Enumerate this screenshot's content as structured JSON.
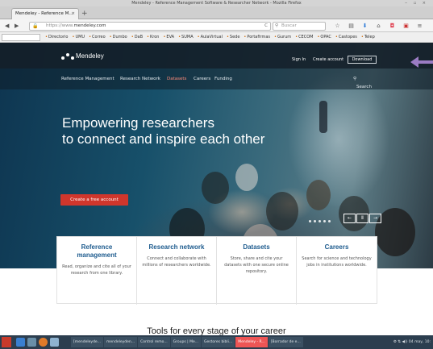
{
  "window": {
    "title": "Mendeley - Reference Management Software & Researcher Network - Mozilla Firefox",
    "controls": "‒ ▫ ×"
  },
  "tab": {
    "title": "Mendeley - Reference M...",
    "close": "×",
    "new_tab": "+"
  },
  "navbar": {
    "back": "◀",
    "forward": "▶",
    "url_prefix": "https://www.",
    "url_host": "mendeley.com",
    "reload": "C",
    "search_placeholder": "Buscar",
    "icons": [
      "star-icon",
      "reading-list-icon",
      "download-icon",
      "home-icon",
      "pocket-icon",
      "firefox-menu-icon",
      "hamburger-icon"
    ]
  },
  "bookmarks": [
    "Directorio",
    "UMU",
    "Correo",
    "Dumbo",
    "DaB",
    "Kron",
    "EVA",
    "SUMA",
    "AulaVirtual",
    "Sede",
    "Portafirmas",
    "Gurum",
    "CECOM",
    "OPAC",
    "Castopes",
    "Telep"
  ],
  "site": {
    "logo": "Mendeley",
    "signin": "Sign In",
    "create_account": "Create account",
    "download": "Download",
    "nav": [
      {
        "label": "Reference Management",
        "active": false
      },
      {
        "label": "Research Network",
        "active": false
      },
      {
        "label": "Datasets",
        "active": true
      },
      {
        "label": "Careers",
        "active": false
      },
      {
        "label": "Funding",
        "active": false
      }
    ],
    "search": "Search",
    "headline_1": "Empowering researchers",
    "headline_2": "to connect and inspire each other",
    "cta": "Create a free account",
    "carousel": {
      "prev": "←",
      "pause": "Ⅱ",
      "next": "→"
    },
    "cards": [
      {
        "title": "Reference management",
        "text": "Read, organize and cite all of your research from one library."
      },
      {
        "title": "Research network",
        "text": "Connect and collaborate with millions of researchers worldwide."
      },
      {
        "title": "Datasets",
        "text": "Store, share and cite your datasets with one secure online repository."
      },
      {
        "title": "Careers",
        "text": "Search for science and technology jobs in institutions worldwide."
      }
    ],
    "tools_heading": "Tools for every stage of your career"
  },
  "taskbar": {
    "tasks": [
      "[mendeleyde...",
      "mendeleyden...",
      "Control remo...",
      "Groups | Me...",
      "Gestores bibli...",
      "Mendeley - R...",
      "[Borrador de e..."
    ],
    "active_task": 5,
    "tray": "04 may, 10:"
  },
  "colors": {
    "accent_red": "#d0362c",
    "card_title": "#1d5b8e",
    "annotation_arrow": "#9b7cc3",
    "active_nav": "#ff8b7a"
  }
}
